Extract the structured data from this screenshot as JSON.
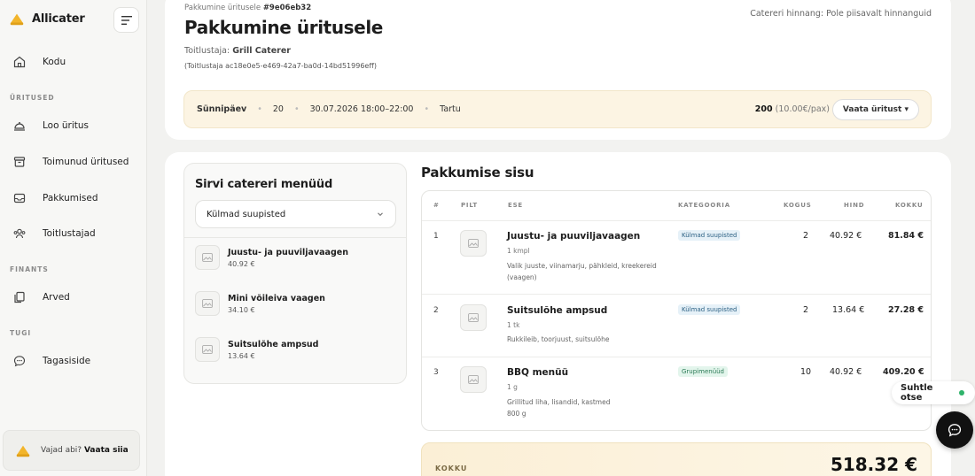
{
  "app": {
    "name": "Allicater"
  },
  "sidebar": {
    "home": "Kodu",
    "section_events": "ÜRITUSED",
    "create_event": "Loo üritus",
    "past_events": "Toimunud üritused",
    "offers": "Pakkumised",
    "caterers": "Toitlustajad",
    "section_finance": "FINANTS",
    "invoices": "Arved",
    "section_support": "TUGI",
    "feedback": "Tagasiside",
    "help_text": "Vajad abi?",
    "help_link": "Vaata siia"
  },
  "header": {
    "offer_prefix": "Pakkumine üritusele",
    "offer_id": "#9e06eb32",
    "title": "Pakkumine üritusele",
    "caterer_label": "Toitlustaja:",
    "caterer_name": "Grill Caterer",
    "caterer_id": "(Toitlustaja ac18e0e5-e469-42a7-ba0d-14bd51996eff)",
    "price_note": "Catereri hinnang: Pole piisavalt hinnanguid"
  },
  "event": {
    "type": "Sünnipäev",
    "guests": "20",
    "datetime": "30.07.2026 18:00–22:00",
    "location": "Tartu",
    "total": "200",
    "per_person": "(10.00€/pax)",
    "view_button": "Vaata üritust ▾"
  },
  "browse": {
    "title": "Sirvi catereri menüüd",
    "selected_category": "Külmad suupisted",
    "items": [
      {
        "name": "Juustu- ja puuviljavaagen",
        "price": "40.92 €"
      },
      {
        "name": "Mini võileiva vaagen",
        "price": "34.10 €"
      },
      {
        "name": "Suitsulõhe ampsud",
        "price": "13.64 €"
      }
    ]
  },
  "offer": {
    "title": "Pakkumise sisu",
    "columns": {
      "num": "#",
      "image": "PILT",
      "item": "ESE",
      "category": "KATEGOORIA",
      "qty": "KOGUS",
      "price": "HIND",
      "total": "KOKKU"
    },
    "rows": [
      {
        "num": "1",
        "name": "Juustu- ja puuviljavaagen",
        "unit": "1 kmpl",
        "desc": "Valik juuste, viinamarju, pähkleid, kreekereid (vaagen)",
        "category": "Külmad suupisted",
        "qty": "2",
        "price": "40.92 €",
        "total": "81.84 €"
      },
      {
        "num": "2",
        "name": "Suitsulõhe ampsud",
        "unit": "1 tk",
        "desc": "Rukkileib, toorjuust, suitsulõhe",
        "category": "Külmad suupisted",
        "qty": "2",
        "price": "13.64 €",
        "total": "27.28 €"
      },
      {
        "num": "3",
        "name": "BBQ menüü",
        "unit": "1 g",
        "desc": "Grillitud liha, lisandid, kastmed",
        "desc2": "800 g",
        "category": "Grupimenüüd",
        "qty": "10",
        "price": "40.92 €",
        "total": "409.20 €"
      }
    ],
    "total_label": "KOKKU",
    "total_value": "518.32 €"
  },
  "chat": {
    "label": "Suhtle otse"
  },
  "colors": {
    "accent_bg": "#fcf4e3",
    "badge_blue": "#e6f1f8",
    "badge_green": "#e3f5ec",
    "online": "#2fb36b"
  }
}
